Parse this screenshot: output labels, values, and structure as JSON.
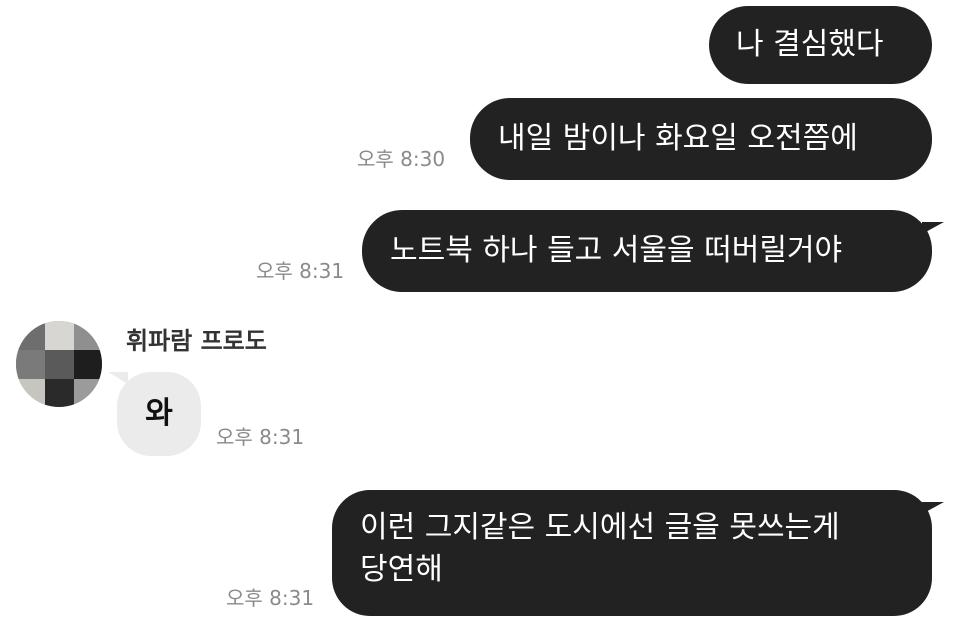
{
  "messages_out": [
    {
      "text": "나 결심했다",
      "time": ""
    },
    {
      "text": "내일 밤이나 화요일 오전쯤에",
      "time": "오후 8:30"
    },
    {
      "text": "노트북 하나 들고 서울을 떠버릴거야",
      "time": "오후 8:31"
    },
    {
      "line1": "이런 그지같은 도시에선 글을 못쓰는게",
      "line2": "당연해",
      "time": "오후 8:31"
    }
  ],
  "incoming": {
    "sender": "휘파람 프로도",
    "text": "와",
    "time": "오후 8:31"
  },
  "colors": {
    "outgoing_bubble": "#222222",
    "incoming_bubble": "#ebebeb",
    "timestamp": "#8a8a8a"
  },
  "icons": {
    "avatar": "pixelated-avatar-image"
  }
}
